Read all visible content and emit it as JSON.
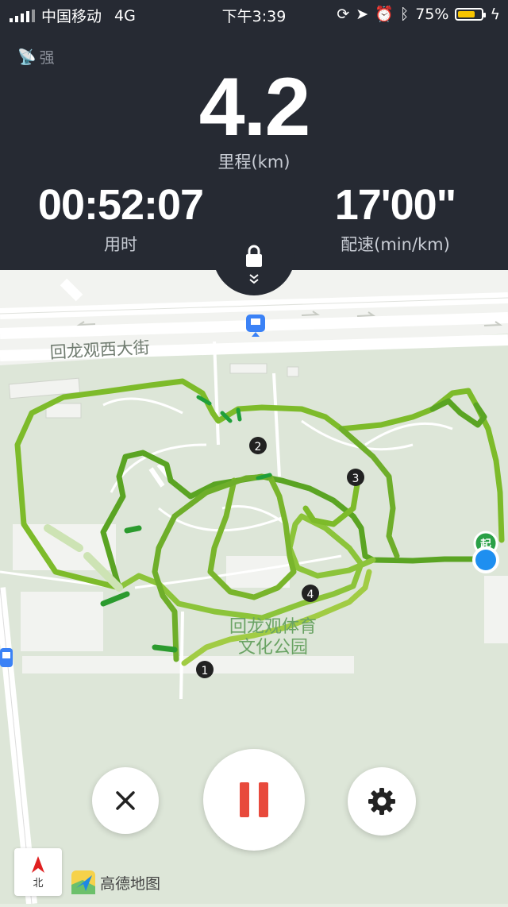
{
  "status_bar": {
    "carrier": "中国移动",
    "network": "4G",
    "time": "下午3:39",
    "battery_percent": "75%",
    "battery_level": 0.75
  },
  "gps": {
    "signal_label": "强"
  },
  "metrics": {
    "distance": "4.2",
    "distance_label": "里程(km)",
    "duration": "00:52:07",
    "duration_label": "用时",
    "pace": "17'00\"",
    "pace_label": "配速(min/km)"
  },
  "map": {
    "street_label": "回龙观西大街",
    "park_label_line1": "回龙观体育",
    "park_label_line2": "文化公园",
    "start_marker": "起",
    "km_markers": [
      "1",
      "2",
      "3",
      "4"
    ],
    "compass_label": "北",
    "logo_text": "高德地图"
  },
  "colors": {
    "dashboard_bg": "#262a33",
    "route_green": "#7dbb2a",
    "pause_red": "#e84a3c",
    "location_blue": "#1e8ff0"
  }
}
